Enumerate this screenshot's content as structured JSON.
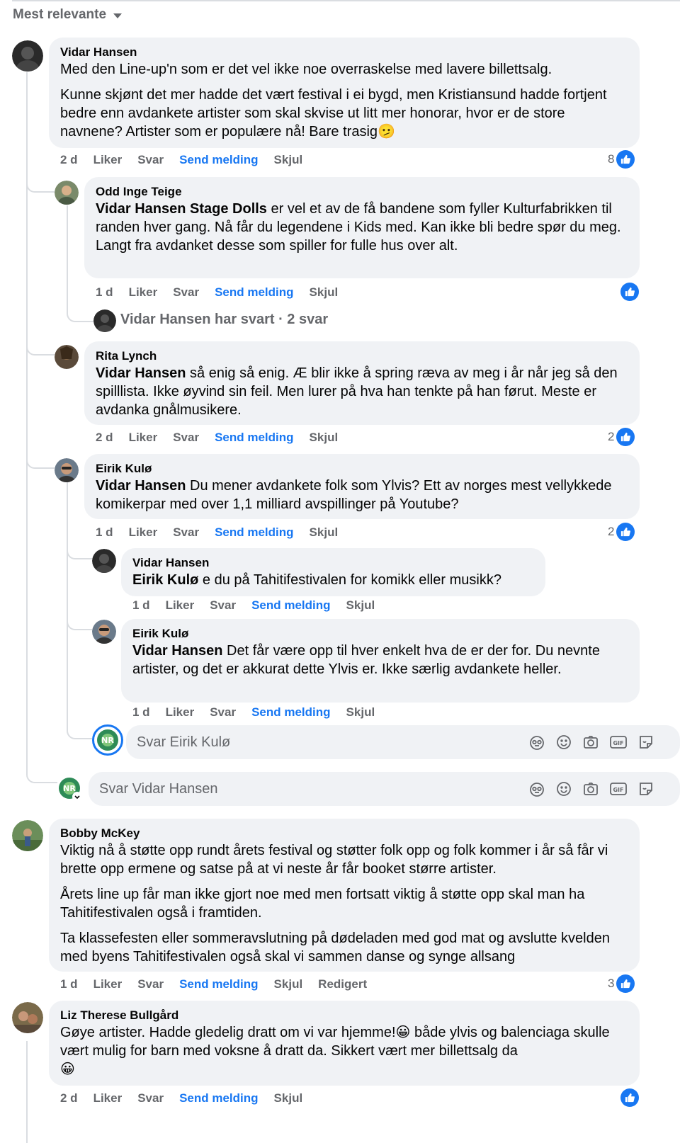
{
  "sort": {
    "label": "Mest relevante"
  },
  "actions": {
    "like": "Liker",
    "reply": "Svar",
    "message": "Send melding",
    "hide": "Skjul",
    "edited": "Redigert"
  },
  "comments": [
    {
      "author": "Vidar Hansen",
      "paragraphs": [
        "Med den Line-up'n som er det vel ikke noe overraskelse med lavere billettsalg.",
        "Kunne skjønt det mer hadde det vært festival i ei bygd, men Kristiansund hadde fortjent bedre enn avdankete artister som skal skvise ut litt mer honorar, hvor er de store navnene? Artister som er populære nå! Bare trasig"
      ],
      "emoji": "🫤",
      "time": "2 d",
      "reactions": "8"
    },
    {
      "author": "Odd Inge Teige",
      "tag": "Vidar Hansen Stage Dolls",
      "text": " er vel et av de få bandene som fyller Kulturfabrikken til randen hver gang. Nå får du legendene i Kids med. Kan ikke bli bedre spør du meg. Langt fra avdanket desse som spiller for fulle hus over alt.",
      "time": "1 d",
      "reactions": "",
      "summary": "Vidar Hansen har svart · 2 svar"
    },
    {
      "author": "Rita Lynch",
      "tag": "Vidar Hansen",
      "text": " så enig så enig. Æ blir ikke å spring ræva av meg i år når jeg så den spilllista. Ikke øyvind sin feil. Men lurer på hva han tenkte på han førut. Meste er avdanka gnålmusikere.",
      "time": "2 d",
      "reactions": "2"
    },
    {
      "author": "Eirik Kulø",
      "tag": "Vidar Hansen",
      "text": " Du mener avdankete folk som Ylvis? Ett av norges mest vellykkede komikerpar med over 1,1 milliard avspillinger på Youtube?",
      "time": "1 d",
      "reactions": "2"
    },
    {
      "author": "Vidar Hansen",
      "tag": "Eirik Kulø",
      "text": " e du på Tahitifestivalen for komikk eller musikk?",
      "time": "1 d"
    },
    {
      "author": "Eirik Kulø",
      "tag": "Vidar Hansen",
      "text": " Det får være opp til hver enkelt hva de er der for. Du nevnte artister, og det er akkurat dette Ylvis er. Ikke særlig avdankete heller.",
      "time": "1 d"
    },
    {
      "author": "Bobby McKey",
      "paragraphs": [
        "Viktig nå å støtte opp rundt årets festival og støtter folk opp og folk kommer i år så får vi brette opp ermene og satse på at vi neste år får booket større artister.",
        "Årets line up får man ikke gjort noe med men fortsatt viktig å støtte opp skal man ha Tahitifestivalen også i framtiden.",
        "Ta klassefesten eller sommeravslutning på dødeladen med god mat og avslutte kvelden med byens Tahitifestivalen også skal vi sammen danse og synge allsang"
      ],
      "time": "1 d",
      "reactions": "3"
    },
    {
      "author": "Liz Therese Bullgård",
      "text_a": "Gøye artister. Hadde gledelig dratt om vi var hjemme!",
      "text_b": " både ylvis og balenciaga skulle vært mulig for barn med voksne å dratt da. Sikkert vært mer billettsalg da",
      "emoji": "😀",
      "time": "2 d",
      "reactions": ""
    }
  ],
  "reply_boxes": [
    {
      "placeholder": "Svar Eirik Kulø"
    },
    {
      "placeholder": "Svar Vidar Hansen"
    }
  ],
  "colors": {
    "accent": "#1877f2",
    "bubble": "#f0f2f5",
    "muted": "#65676b"
  }
}
